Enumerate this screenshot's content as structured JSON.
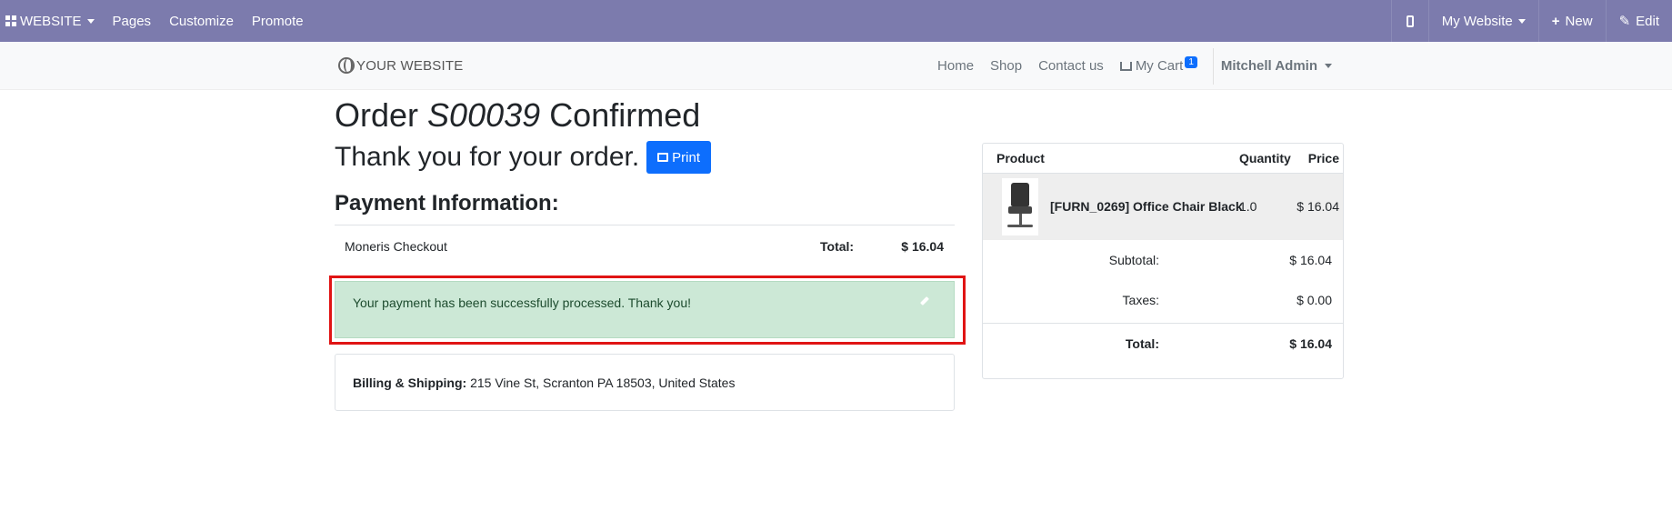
{
  "adminbar": {
    "website_menu": "WEBSITE",
    "pages": "Pages",
    "customize": "Customize",
    "promote": "Promote",
    "site_selector": "My Website",
    "new": "New",
    "edit": "Edit"
  },
  "site": {
    "logo": "YOUR WEBSITE",
    "nav": {
      "home": "Home",
      "shop": "Shop",
      "contact": "Contact us",
      "cart": "My Cart",
      "cart_count": "1",
      "user": "Mitchell Admin"
    }
  },
  "order": {
    "title_prefix": "Order",
    "order_ref": "S00039",
    "title_suffix": "Confirmed",
    "thanks": "Thank you for your order.",
    "print": "Print",
    "payment_heading": "Payment Information:",
    "payment_method": "Moneris Checkout",
    "total_label": "Total:",
    "total_value": "$ 16.04",
    "success_message": "Your payment has been successfully processed. Thank you!",
    "billing_label": "Billing & Shipping:",
    "billing_address": " 215 Vine St, Scranton PA 18503, United States"
  },
  "summary": {
    "headers": {
      "product": "Product",
      "quantity": "Quantity",
      "price": "Price"
    },
    "item": {
      "name": "[FURN_0269] Office Chair Black",
      "qty": "1.0",
      "price": "$ 16.04"
    },
    "subtotal_label": "Subtotal:",
    "subtotal_value": "$ 16.04",
    "taxes_label": "Taxes:",
    "taxes_value": "$ 0.00",
    "total_label": "Total:",
    "total_value": "$ 16.04"
  },
  "colors": {
    "adminbar": "#7c7bad",
    "primary": "#0d6efd",
    "success_bg": "#cce8d6",
    "highlight": "#e01414"
  }
}
